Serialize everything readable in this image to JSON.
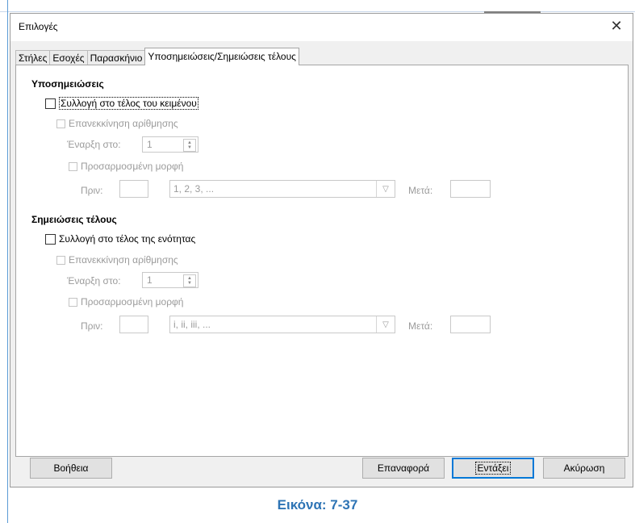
{
  "dialog": {
    "title": "Επιλογές"
  },
  "tabs": [
    "Στήλες",
    "Εσοχές",
    "Παρασκήνιο",
    "Υποσημειώσεις/Σημειώσεις τέλους"
  ],
  "footnotes": {
    "heading": "Υποσημειώσεις",
    "collect": "Συλλογή στο τέλος του κειμένου",
    "restart": "Επανεκκίνηση αρίθμησης",
    "start_label": "Έναρξη στο:",
    "start_value": "1",
    "custom": "Προσαρμοσμένη μορφή",
    "before_label": "Πριν:",
    "format_value": "1, 2, 3, ...",
    "after_label": "Μετά:"
  },
  "endnotes": {
    "heading": "Σημειώσεις τέλους",
    "collect": "Συλλογή στο τέλος της ενότητας",
    "restart": "Επανεκκίνηση αρίθμησης",
    "start_label": "Έναρξη στο:",
    "start_value": "1",
    "custom": "Προσαρμοσμένη μορφή",
    "before_label": "Πριν:",
    "format_value": "i, ii, iii, ...",
    "after_label": "Μετά:"
  },
  "buttons": {
    "help": "Βοήθεια",
    "reset": "Επαναφορά",
    "ok": "Εντάξει",
    "cancel": "Ακύρωση"
  },
  "caption": "Εικόνα: 7-37",
  "colors": {
    "accent": "#0078d7",
    "caption": "#2e74b5",
    "disabled_text": "#9b9b9b"
  }
}
